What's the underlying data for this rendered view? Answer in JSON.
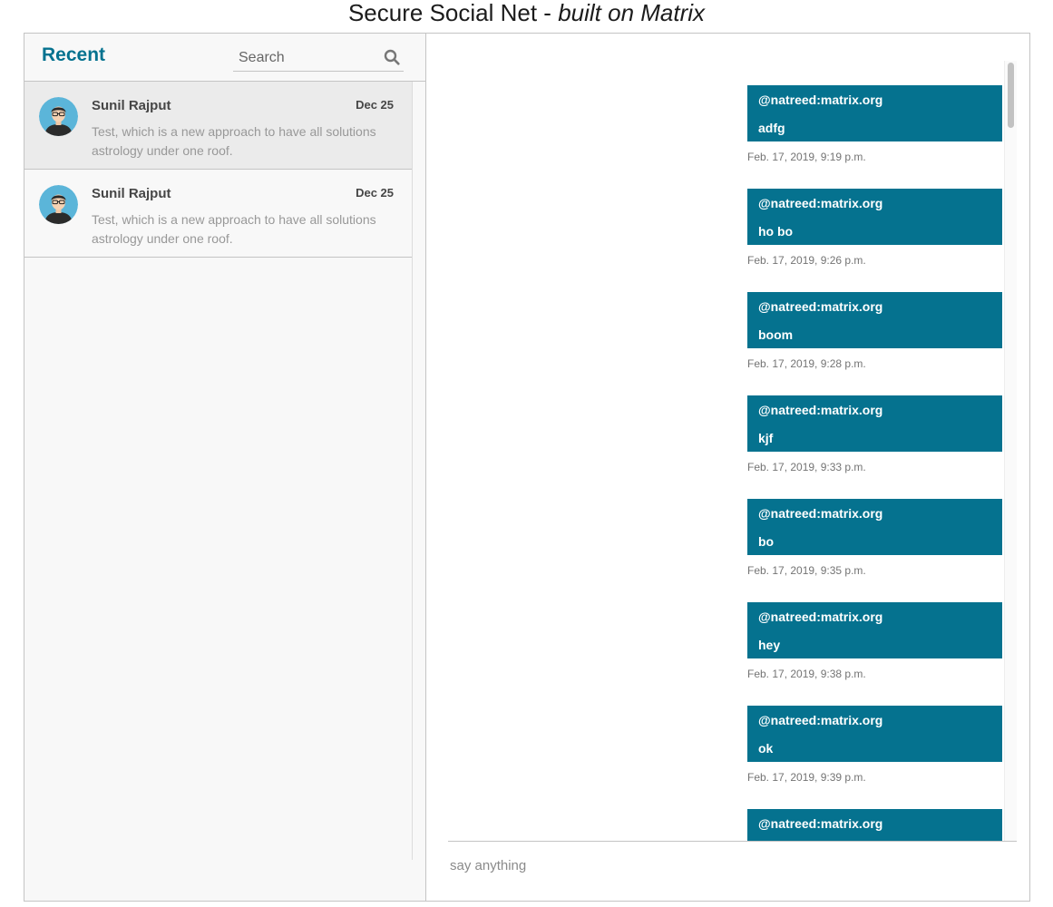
{
  "page": {
    "title_main": "Secure Social Net - ",
    "title_em": "built on Matrix"
  },
  "inbox": {
    "heading": "Recent",
    "search_placeholder": "Search",
    "chats": [
      {
        "name": "Sunil Rajput",
        "date": "Dec 25",
        "preview": "Test, which is a new approach to have all solutions astrology under one roof."
      },
      {
        "name": "Sunil Rajput",
        "date": "Dec 25",
        "preview": "Test, which is a new approach to have all solutions astrology under one roof."
      }
    ]
  },
  "messages": [
    {
      "sender": "@natreed:matrix.org",
      "body": "adfg",
      "time": "Feb. 17, 2019, 9:19 p.m."
    },
    {
      "sender": "@natreed:matrix.org",
      "body": "ho bo",
      "time": "Feb. 17, 2019, 9:26 p.m."
    },
    {
      "sender": "@natreed:matrix.org",
      "body": "boom",
      "time": "Feb. 17, 2019, 9:28 p.m."
    },
    {
      "sender": "@natreed:matrix.org",
      "body": "kjf",
      "time": "Feb. 17, 2019, 9:33 p.m."
    },
    {
      "sender": "@natreed:matrix.org",
      "body": "bo",
      "time": "Feb. 17, 2019, 9:35 p.m."
    },
    {
      "sender": "@natreed:matrix.org",
      "body": "hey",
      "time": "Feb. 17, 2019, 9:38 p.m."
    },
    {
      "sender": "@natreed:matrix.org",
      "body": "ok",
      "time": "Feb. 17, 2019, 9:39 p.m."
    },
    {
      "sender": "@natreed:matrix.org",
      "body": "",
      "time": ""
    }
  ],
  "composer": {
    "placeholder": "say anything"
  },
  "colors": {
    "accent": "#05728f",
    "border": "#c4c4c4",
    "sidebar_bg": "#f8f8f8",
    "active_chat_bg": "#ebebeb"
  },
  "icons": {
    "search": "search-icon",
    "avatar": "user-avatar"
  }
}
